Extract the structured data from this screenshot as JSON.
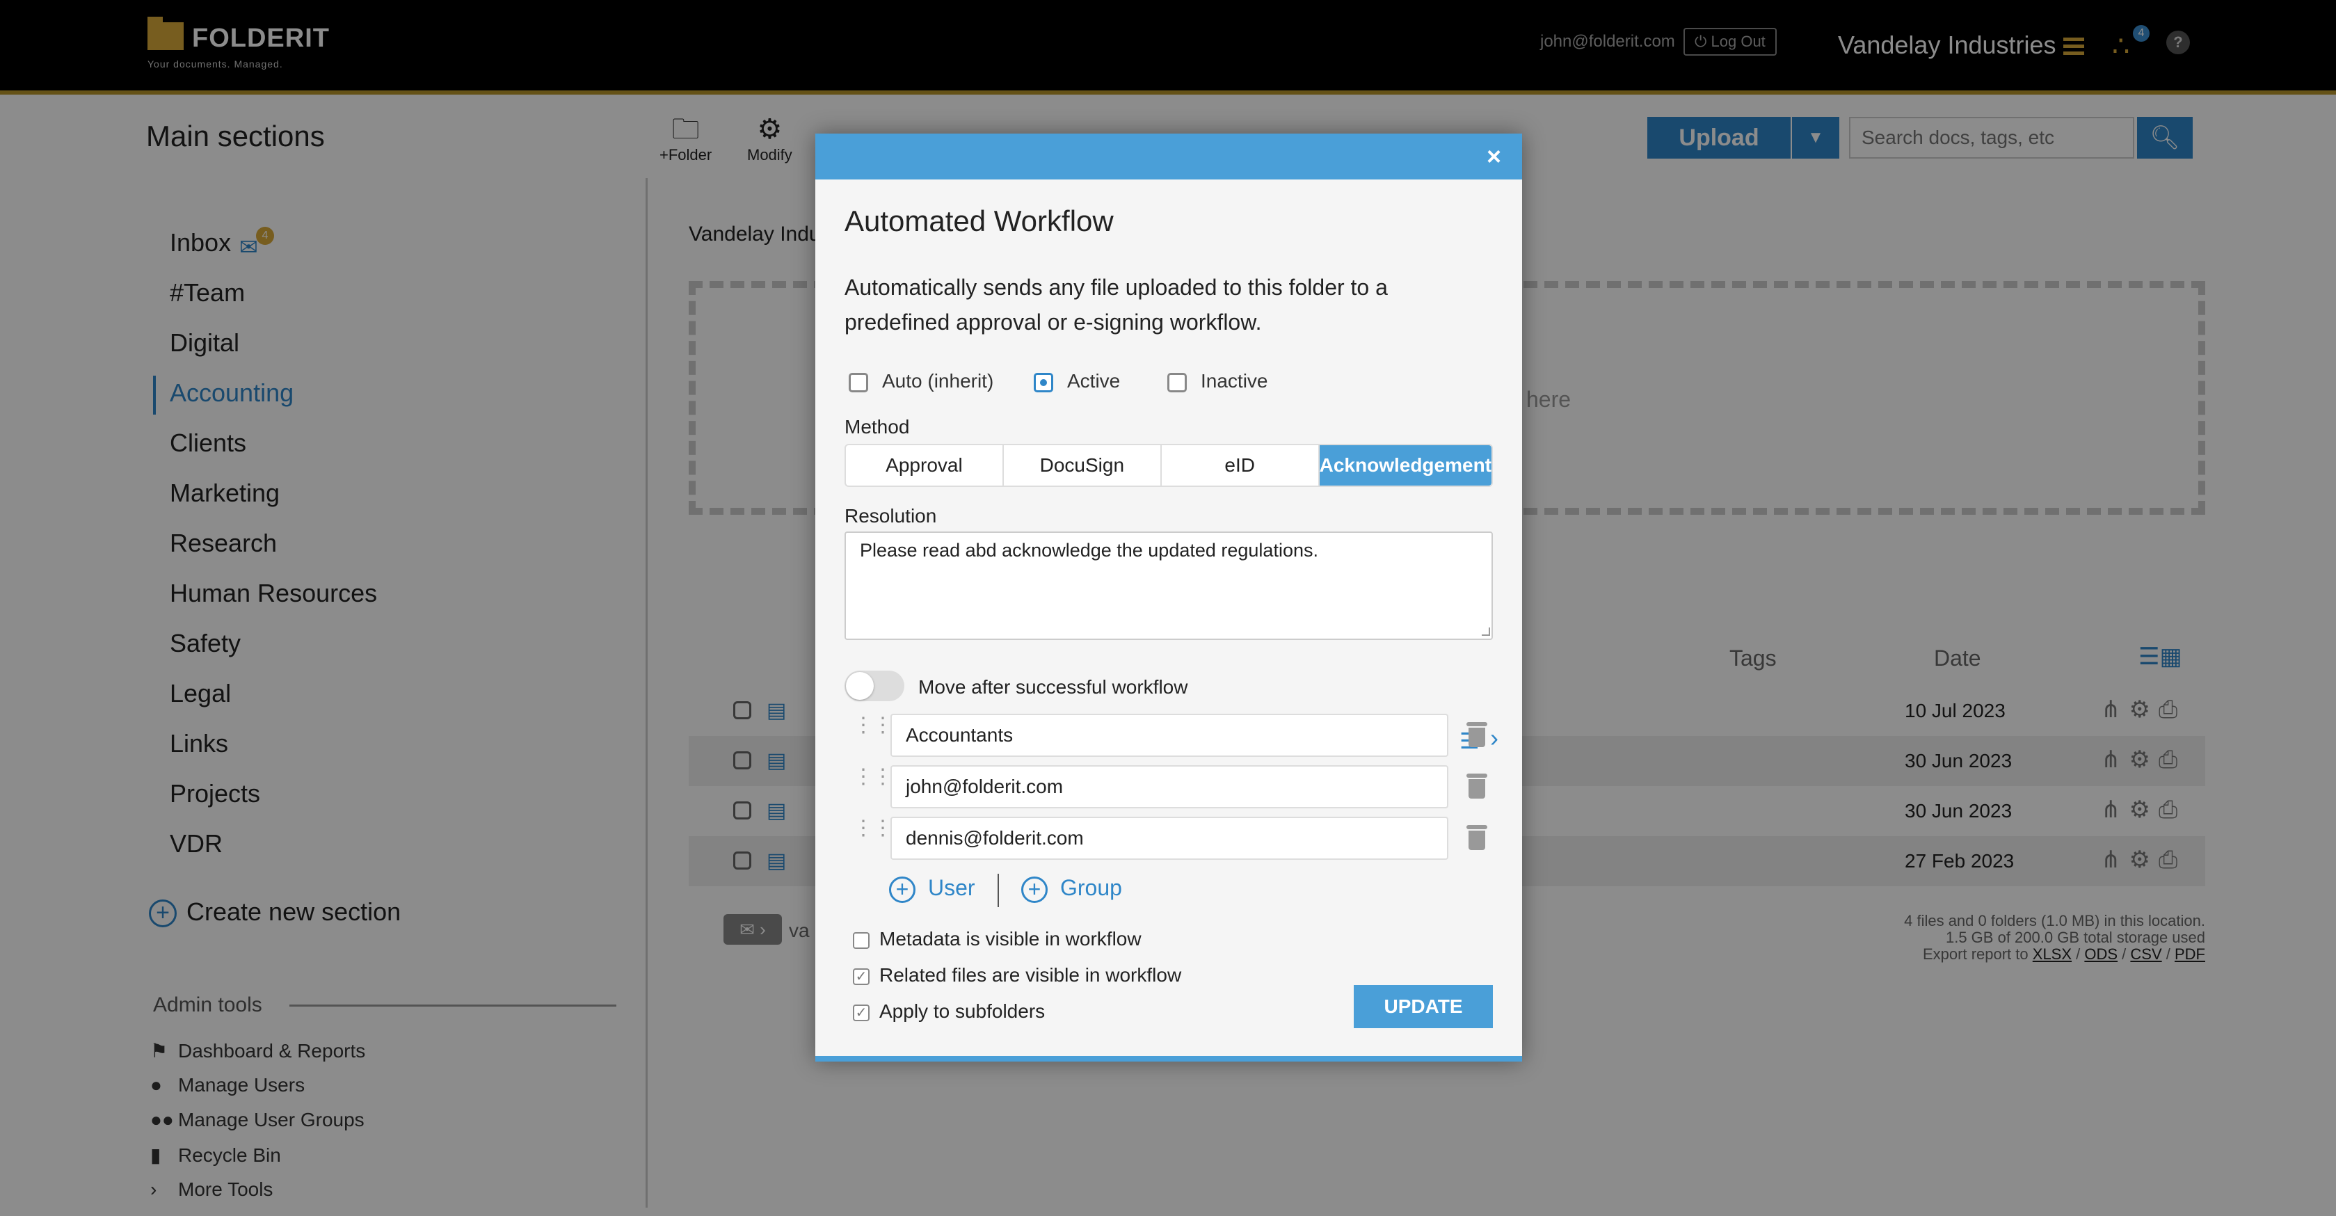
{
  "topbar": {
    "logo_text": "FOLDERIT",
    "logo_tagline": "Your documents. Managed.",
    "user_email": "john@folderit.com",
    "logout_label": "Log Out",
    "company_name": "Vandelay Industries",
    "share_badge": "4",
    "help_label": "?"
  },
  "header": {
    "section_title": "Main sections",
    "toolbar": [
      {
        "label": "+Folder",
        "icon": "folder-plus-icon"
      },
      {
        "label": "Modify",
        "icon": "gear-icon"
      }
    ],
    "upload_label": "Upload",
    "search_placeholder": "Search docs, tags, etc"
  },
  "sidebar": {
    "items": [
      {
        "label": "Inbox"
      },
      {
        "label": "#Team"
      },
      {
        "label": "Digital"
      },
      {
        "label": "Accounting",
        "active": true
      },
      {
        "label": "Clients"
      },
      {
        "label": "Marketing"
      },
      {
        "label": "Research"
      },
      {
        "label": "Human Resources"
      },
      {
        "label": "Safety"
      },
      {
        "label": "Legal"
      },
      {
        "label": "Links"
      },
      {
        "label": "Projects"
      },
      {
        "label": "VDR"
      }
    ],
    "inbox_badge": "4",
    "create_section_label": "Create new section",
    "admin_title": "Admin tools",
    "admin_items": [
      {
        "label": "Dashboard & Reports",
        "icon": "flag-icon"
      },
      {
        "label": "Manage Users",
        "icon": "user-icon"
      },
      {
        "label": "Manage User Groups",
        "icon": "users-icon"
      },
      {
        "label": "Recycle Bin",
        "icon": "trash-icon"
      },
      {
        "label": "More Tools",
        "icon": "chevron-right-icon"
      }
    ]
  },
  "content": {
    "breadcrumb": "Vandelay Indu",
    "dropzone_text": "here",
    "columns": {
      "tags": "Tags",
      "date": "Date"
    },
    "rows": [
      {
        "date": "10 Jul 2023"
      },
      {
        "date": "30 Jun 2023"
      },
      {
        "date": "30 Jun 2023"
      },
      {
        "date": "27 Feb 2023"
      }
    ],
    "mail_text": "va",
    "footer": {
      "line1": "4 files and 0 folders (1.0 MB) in this location.",
      "line2": "1.5 GB of 200.0 GB total storage used",
      "export_prefix": "Export report to",
      "export_formats": [
        "XLSX",
        "ODS",
        "CSV",
        "PDF"
      ]
    }
  },
  "modal": {
    "close_label": "×",
    "title": "Automated Workflow",
    "description": "Automatically sends any file uploaded to this folder to a predefined approval or e-signing workflow.",
    "status_options": [
      {
        "label": "Auto (inherit)",
        "selected": false
      },
      {
        "label": "Active",
        "selected": true
      },
      {
        "label": "Inactive",
        "selected": false
      }
    ],
    "method_label": "Method",
    "methods": [
      {
        "label": "Approval",
        "selected": false
      },
      {
        "label": "DocuSign",
        "selected": false
      },
      {
        "label": "eID",
        "selected": false
      },
      {
        "label": "Acknowledgement",
        "selected": true
      }
    ],
    "resolution_label": "Resolution",
    "resolution_value": "Please read abd acknowledge the updated regulations.",
    "move_toggle_label": "Move after successful workflow",
    "move_toggle_on": false,
    "assignees": [
      {
        "value": "Accountants",
        "type": "group"
      },
      {
        "value": "john@folderit.com",
        "type": "user"
      },
      {
        "value": "dennis@folderit.com",
        "type": "user"
      }
    ],
    "add_user_label": "User",
    "add_group_label": "Group",
    "checkboxes": [
      {
        "label": "Metadata is visible in workflow",
        "checked": false
      },
      {
        "label": "Related files are visible in workflow",
        "checked": true
      },
      {
        "label": "Apply to subfolders",
        "checked": true
      }
    ],
    "update_label": "UPDATE"
  },
  "colors": {
    "accent": "#4a9fd8",
    "brand_gold": "#d9a93a",
    "topbar_bg": "#000000"
  }
}
